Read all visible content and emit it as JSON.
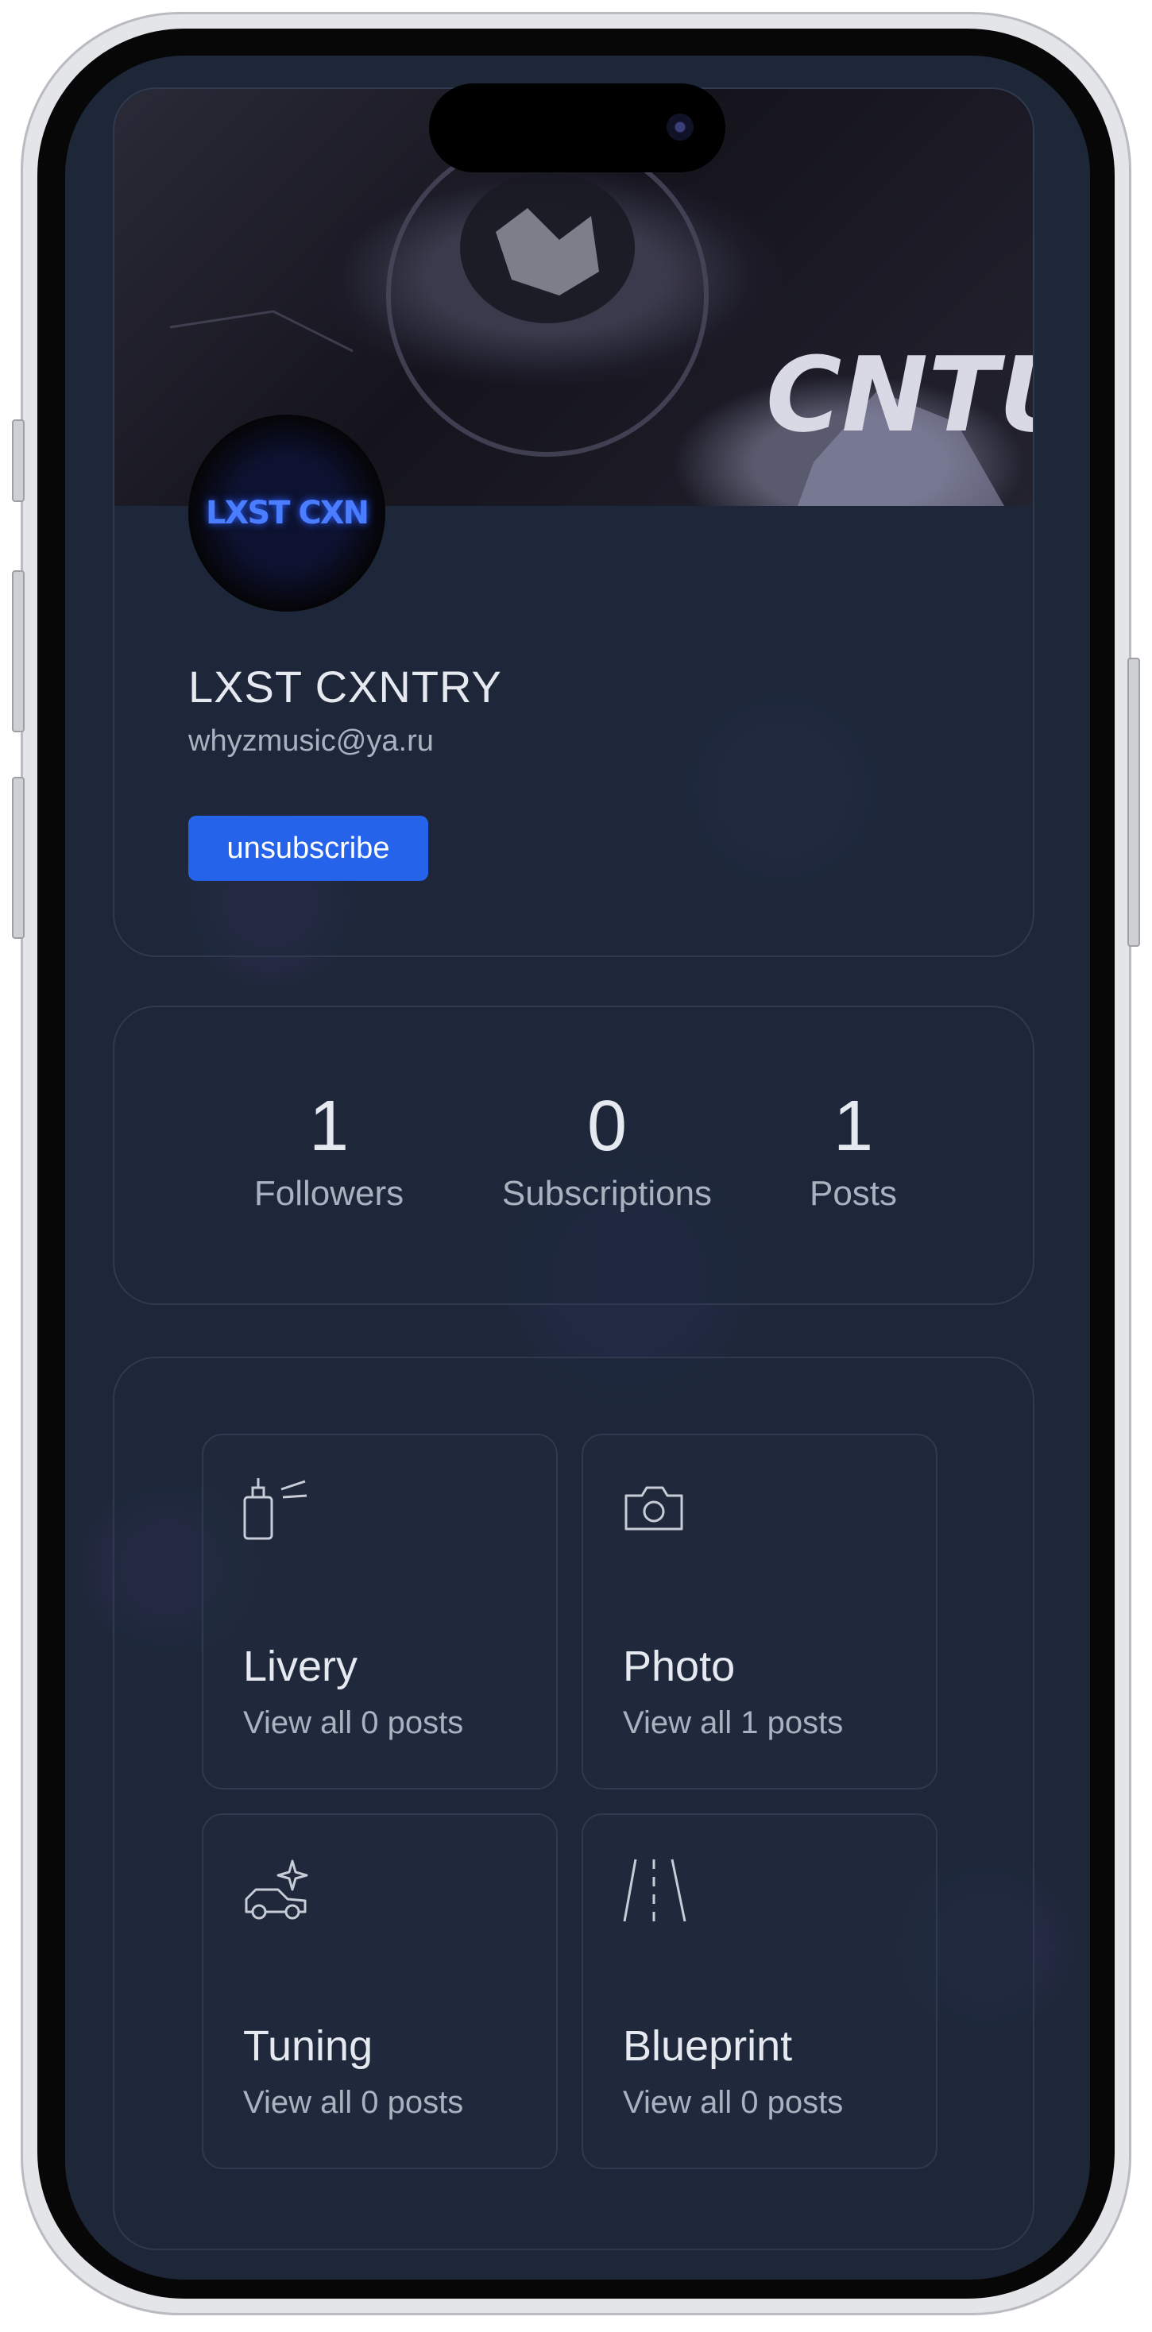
{
  "profile": {
    "banner_text": "CNTU",
    "avatar_text": "LXST CXN",
    "name": "LXST CXNTRY",
    "email": "whyzmusic@ya.ru",
    "unsubscribe_label": "unsubscribe"
  },
  "stats": [
    {
      "value": "1",
      "label": "Followers"
    },
    {
      "value": "0",
      "label": "Subscriptions"
    },
    {
      "value": "1",
      "label": "Posts"
    }
  ],
  "categories": [
    {
      "title": "Livery",
      "subtitle": "View all 0 posts",
      "icon": "spray-can-icon"
    },
    {
      "title": "Photo",
      "subtitle": "View all 1 posts",
      "icon": "camera-icon"
    },
    {
      "title": "Tuning",
      "subtitle": "View all 0 posts",
      "icon": "car-sparkle-icon"
    },
    {
      "title": "Blueprint",
      "subtitle": "View all 0 posts",
      "icon": "road-icon"
    }
  ],
  "colors": {
    "background": "#1d2738",
    "accent": "#2563eb",
    "text_primary": "#e6e9ef",
    "text_secondary": "#aab2bf"
  }
}
